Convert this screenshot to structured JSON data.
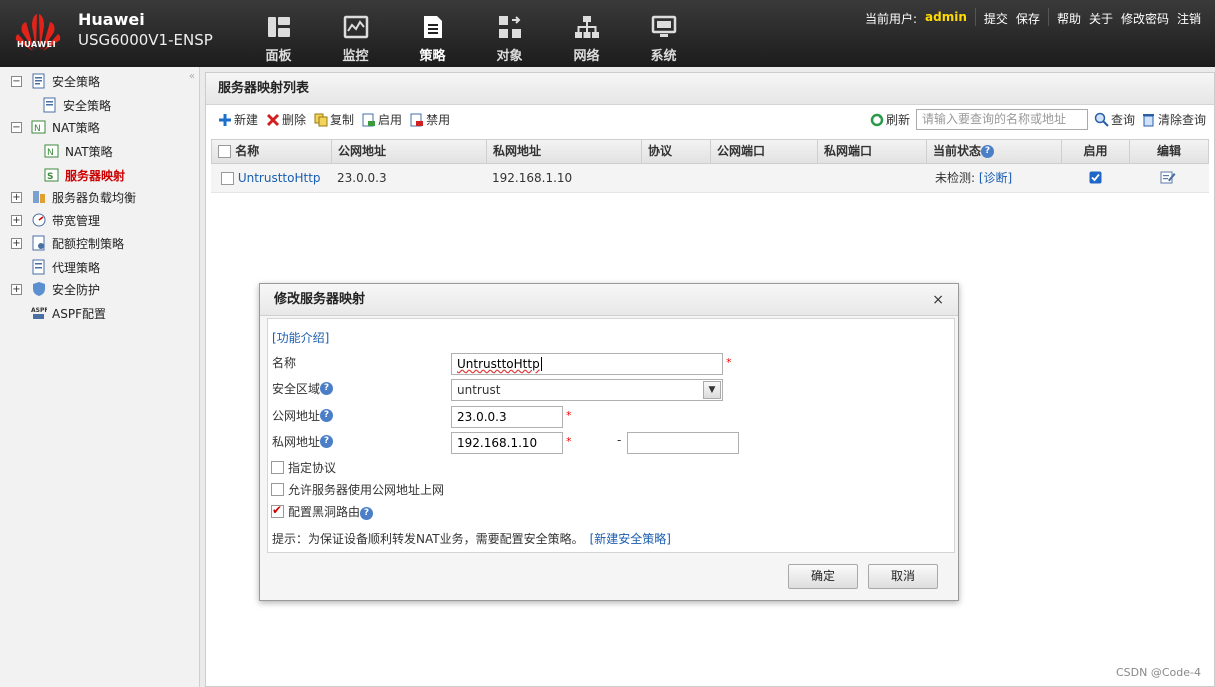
{
  "header": {
    "brand_name": "Huawei",
    "brand_logo_text": "HUAWEI",
    "device_model": "USG6000V1-ENSP",
    "nav": [
      {
        "label": "面板",
        "icon": "dashboard-icon"
      },
      {
        "label": "监控",
        "icon": "monitor-icon"
      },
      {
        "label": "策略",
        "icon": "policy-icon",
        "active": true
      },
      {
        "label": "对象",
        "icon": "object-icon"
      },
      {
        "label": "网络",
        "icon": "network-icon"
      },
      {
        "label": "系统",
        "icon": "system-icon"
      }
    ],
    "current_user_label": "当前用户:",
    "current_user": "admin",
    "links": [
      "提交",
      "保存",
      "帮助",
      "关于",
      "修改密码",
      "注销"
    ],
    "accent_user": "#ffd900"
  },
  "sidebar": {
    "items": [
      {
        "label": "安全策略",
        "expand": "−"
      },
      {
        "label": "安全策略"
      },
      {
        "label": "NAT策略",
        "expand": "−"
      },
      {
        "label": "NAT策略"
      },
      {
        "label": "服务器映射",
        "selected": true
      },
      {
        "label": "服务器负载均衡",
        "expand": "+"
      },
      {
        "label": "带宽管理",
        "expand": "+"
      },
      {
        "label": "配额控制策略",
        "expand": "+"
      },
      {
        "label": "代理策略"
      },
      {
        "label": "安全防护",
        "expand": "+"
      },
      {
        "label": "ASPF配置"
      }
    ],
    "collapse_glyph": "«"
  },
  "main": {
    "title": "服务器映射列表",
    "toolbar": {
      "new": "新建",
      "delete": "删除",
      "copy": "复制",
      "enable": "启用",
      "disable": "禁用",
      "refresh": "刷新",
      "search_placeholder": "请输入要查询的名称或地址",
      "query": "查询",
      "clear_query": "清除查询"
    },
    "table": {
      "columns": [
        "名称",
        "公网地址",
        "私网地址",
        "协议",
        "公网端口",
        "私网端口",
        "当前状态",
        "启用",
        "编辑"
      ],
      "rows": [
        {
          "name": "UntrusttoHttp",
          "public_addr": "23.0.0.3",
          "private_addr": "192.168.1.10",
          "protocol": "",
          "public_port": "",
          "private_port": "",
          "status": "未检测:",
          "diagnose": "[诊断]",
          "enabled": true
        }
      ]
    }
  },
  "dialog": {
    "title": "修改服务器映射",
    "close": "×",
    "intro_link": "[功能介绍]",
    "fields": {
      "name_label": "名称",
      "name_value": "UntrusttoHttp",
      "zone_label": "安全区域",
      "zone_value": "untrust",
      "public_label": "公网地址",
      "public_value": "23.0.0.3",
      "private_label": "私网地址",
      "private_value": "192.168.1.10",
      "private_range_sep": "-",
      "private_range_end": "",
      "required_mark": "*"
    },
    "options": [
      {
        "label": "指定协议",
        "checked": false
      },
      {
        "label": "允许服务器使用公网地址上网",
        "checked": false
      },
      {
        "label": "配置黑洞路由",
        "checked": true
      }
    ],
    "hint": "提示：为保证设备顺利转发NAT业务，需要配置安全策略。",
    "hint_link": "[新建安全策略]",
    "ok": "确定",
    "cancel": "取消"
  },
  "watermark": "CSDN @Code-4"
}
